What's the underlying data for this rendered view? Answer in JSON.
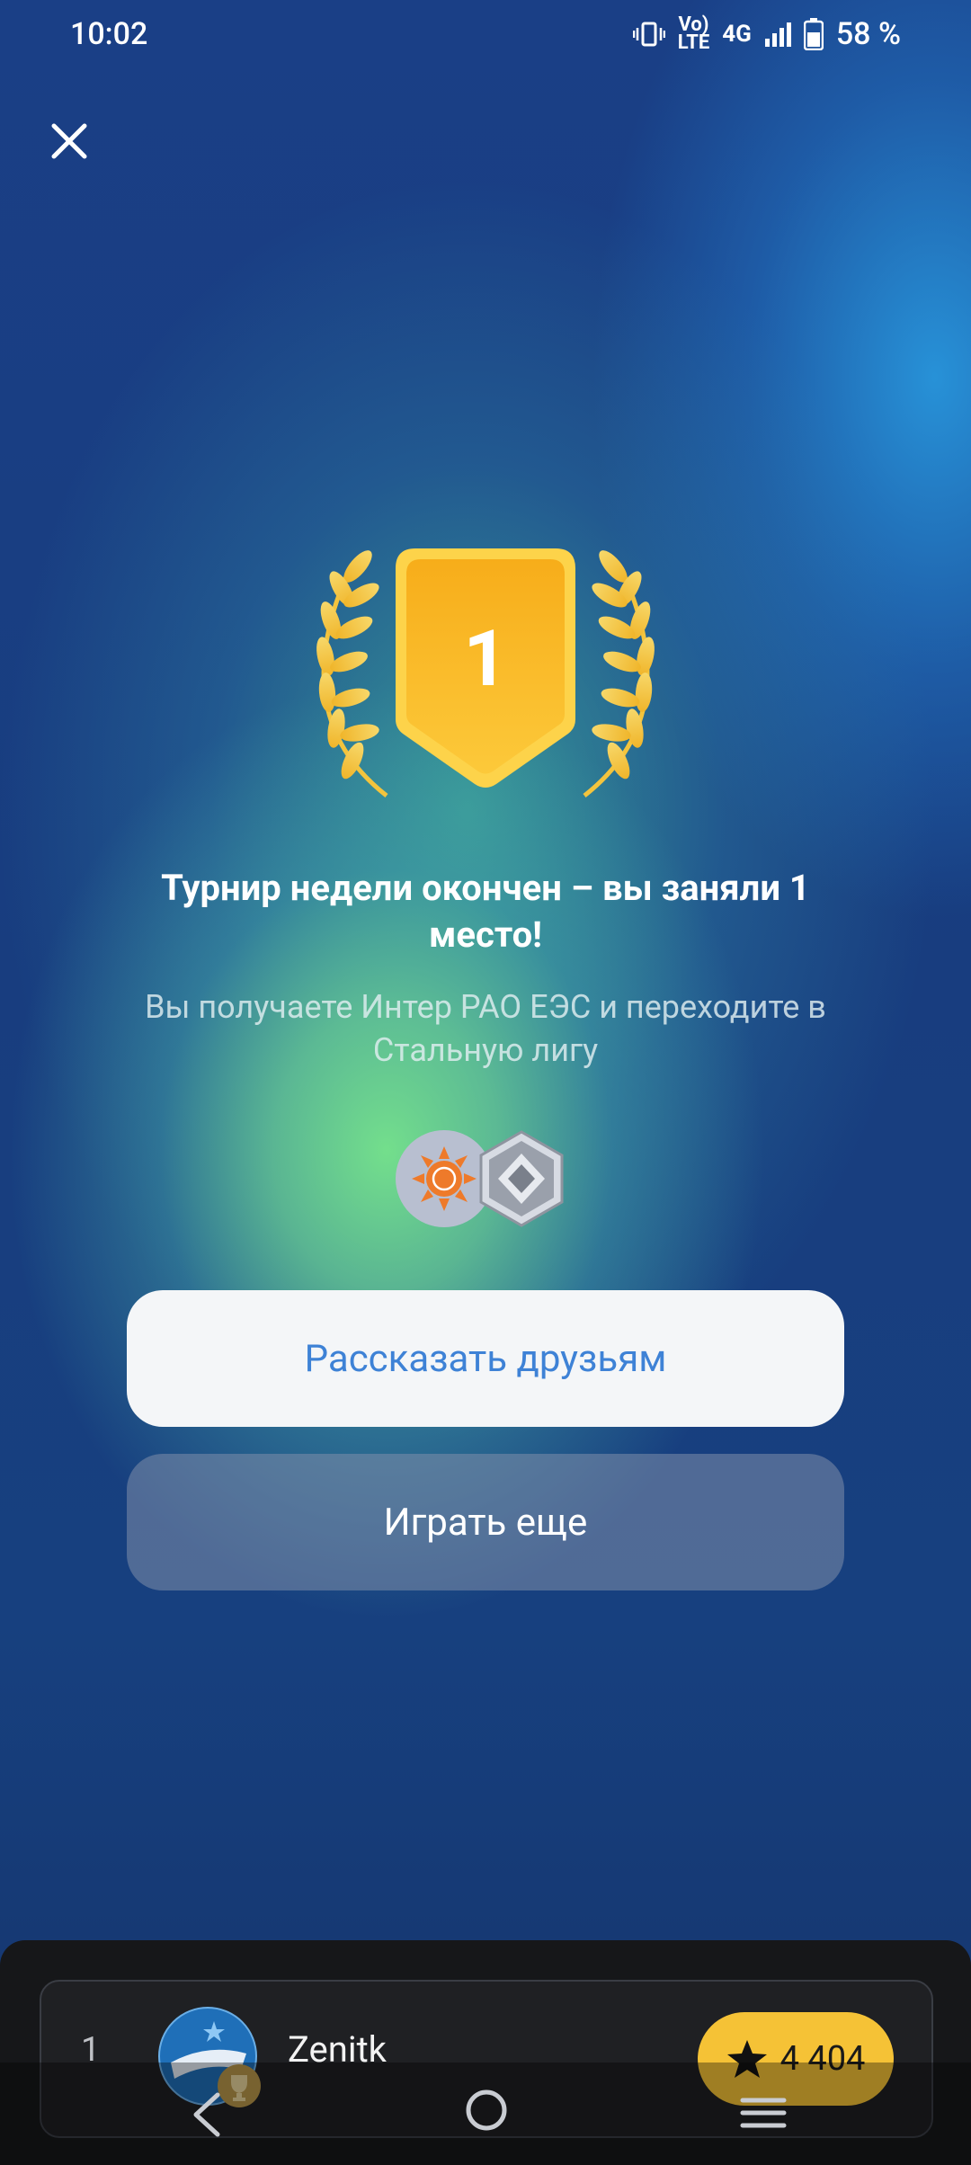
{
  "status_bar": {
    "time": "10:02",
    "volte_line1": "Vo)",
    "volte_line2": "LTE",
    "network": "4G",
    "battery": "58 %"
  },
  "result": {
    "place_number": "1",
    "title": "Турнир недели окончен – вы заняли 1 место!",
    "subtitle": "Вы получаете Интер РАО ЕЭС и переходите в Стальную лигу"
  },
  "buttons": {
    "share_label": "Рассказать друзьям",
    "play_again_label": "Играть еще"
  },
  "leaderboard": {
    "rank": "1",
    "name": "Zenitk",
    "score": "4 404"
  },
  "colors": {
    "accent_gold": "#f5c236",
    "link_blue": "#3e82d6"
  }
}
